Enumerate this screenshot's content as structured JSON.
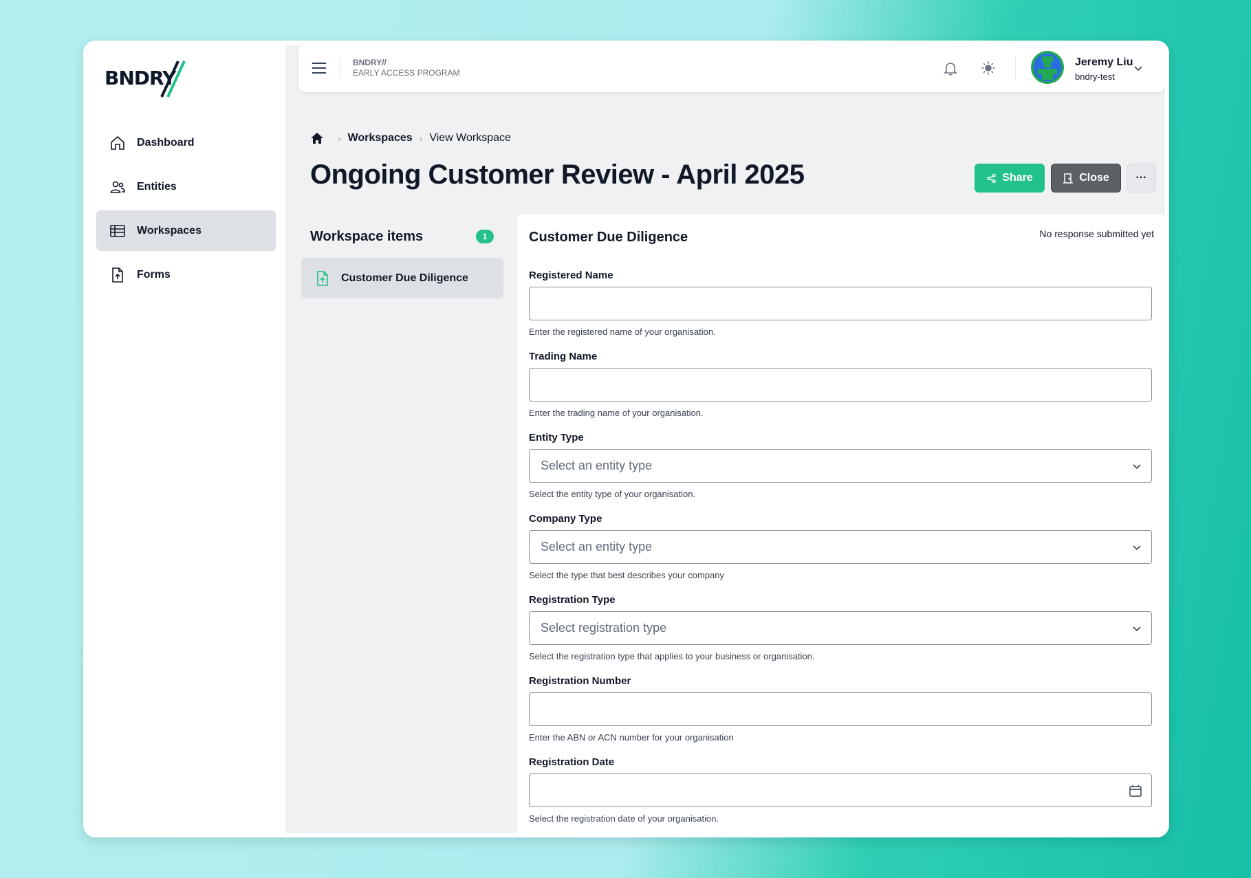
{
  "brand": {
    "logo_text": "BNDRY",
    "small_line1": "BNDRY//",
    "small_line2": "EARLY ACCESS PROGRAM"
  },
  "colors": {
    "accent": "#22c08a",
    "close_button": "#5c6166",
    "avatar_bg": "#22a852"
  },
  "sidebar": {
    "items": [
      {
        "label": "Dashboard",
        "icon": "home-icon"
      },
      {
        "label": "Entities",
        "icon": "users-icon"
      },
      {
        "label": "Workspaces",
        "icon": "table-icon",
        "active": true
      },
      {
        "label": "Forms",
        "icon": "file-upload-icon"
      }
    ]
  },
  "user": {
    "name": "Jeremy Liu",
    "org": "bndry-test"
  },
  "breadcrumb": {
    "link": "Workspaces",
    "current": "View Workspace"
  },
  "page": {
    "title": "Ongoing Customer Review - April 2025"
  },
  "actions": {
    "share": "Share",
    "close": "Close",
    "more": "···"
  },
  "workspace_items": {
    "title": "Workspace items",
    "count": "1",
    "items": [
      "Customer Due Diligence"
    ]
  },
  "form": {
    "title": "Customer Due Diligence",
    "status": "No response submitted yet",
    "fields": [
      {
        "label": "Registered Name",
        "value": "",
        "hint": "Enter the registered name of your organisation."
      },
      {
        "label": "Trading Name",
        "value": "",
        "hint": "Enter the trading name of your organisation."
      },
      {
        "label": "Entity Type",
        "placeholder": "Select an entity type",
        "hint": "Select the entity type of your organisation."
      },
      {
        "label": "Company Type",
        "placeholder": "Select an entity type",
        "hint": "Select the type that best describes your company"
      },
      {
        "label": "Registration Type",
        "placeholder": "Select registration type",
        "hint": "Select the registration type that applies to your business or organisation."
      },
      {
        "label": "Registration Number",
        "value": "",
        "hint": "Enter the ABN or ACN number for your organisation"
      },
      {
        "label": "Registration Date",
        "value": "",
        "hint": "Select the registration date of your organisation."
      }
    ]
  }
}
